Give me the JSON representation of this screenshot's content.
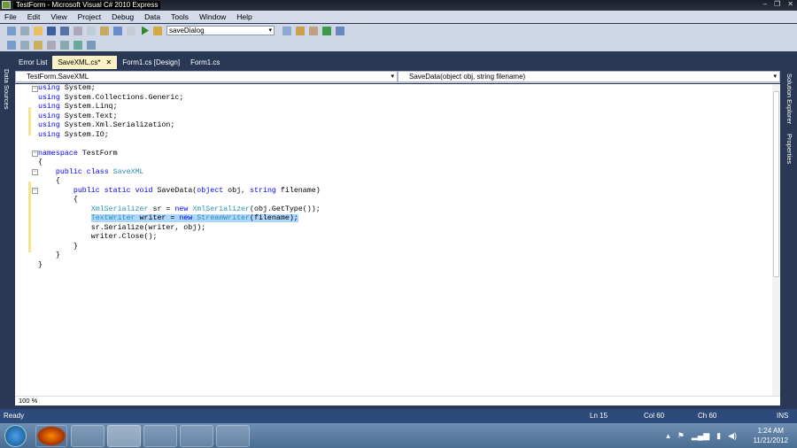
{
  "window": {
    "title": "TestForm - Microsoft Visual C# 2010 Express",
    "controls": [
      "–",
      "❐",
      "✕"
    ]
  },
  "menu": [
    "File",
    "Edit",
    "View",
    "Project",
    "Debug",
    "Data",
    "Tools",
    "Window",
    "Help"
  ],
  "toolbar": {
    "solution_config": "saveDialog"
  },
  "tabs": [
    {
      "label": "Error List",
      "active": false
    },
    {
      "label": "SaveXML.cs*",
      "active": true
    },
    {
      "label": "Form1.cs [Design]",
      "active": false
    },
    {
      "label": "Form1.cs",
      "active": false
    }
  ],
  "tab_close": "✕",
  "nav": {
    "type": "TestForm.SaveXML",
    "member": "SaveData(object obj, string filename)"
  },
  "side": {
    "left": "Data Sources",
    "right1": "Solution Explorer",
    "right2": "Properties"
  },
  "code": [
    [
      [
        "using",
        "kw"
      ],
      [
        " System;",
        ""
      ]
    ],
    [
      [
        "using",
        "kw"
      ],
      [
        " System.Collections.Generic;",
        ""
      ]
    ],
    [
      [
        "using",
        "kw"
      ],
      [
        " System.Linq;",
        ""
      ]
    ],
    [
      [
        "using",
        "kw"
      ],
      [
        " System.Text;",
        ""
      ]
    ],
    [
      [
        "using",
        "kw"
      ],
      [
        " System.Xml.Serialization;",
        ""
      ]
    ],
    [
      [
        "using",
        "kw"
      ],
      [
        " System.IO;",
        ""
      ]
    ],
    [],
    [
      [
        "namespace",
        "kw"
      ],
      [
        " TestForm",
        ""
      ]
    ],
    [
      [
        "{",
        ""
      ]
    ],
    [
      [
        "    ",
        ""
      ],
      [
        "public",
        "kw"
      ],
      [
        " ",
        ""
      ],
      [
        "class",
        "kw"
      ],
      [
        " ",
        ""
      ],
      [
        "SaveXML",
        "ty"
      ]
    ],
    [
      [
        "    {",
        ""
      ]
    ],
    [
      [
        "        ",
        ""
      ],
      [
        "public",
        "kw"
      ],
      [
        " ",
        ""
      ],
      [
        "static",
        "kw"
      ],
      [
        " ",
        ""
      ],
      [
        "void",
        "kw"
      ],
      [
        " SaveData(",
        ""
      ],
      [
        "object",
        "kw"
      ],
      [
        " obj, ",
        ""
      ],
      [
        "string",
        "kw"
      ],
      [
        " filename)",
        ""
      ]
    ],
    [
      [
        "        {",
        ""
      ]
    ],
    [
      [
        "            ",
        ""
      ],
      [
        "XmlSerializer",
        "ty"
      ],
      [
        " sr = ",
        ""
      ],
      [
        "new",
        "kw"
      ],
      [
        " ",
        ""
      ],
      [
        "XmlSerializer",
        "ty"
      ],
      [
        "(obj.GetType());",
        ""
      ]
    ],
    [
      [
        "            ",
        ""
      ],
      [
        "TextWriter",
        "ty sel"
      ],
      [
        " writer = ",
        "sel"
      ],
      [
        "new",
        "kw sel"
      ],
      [
        " ",
        "sel"
      ],
      [
        "StreamWriter",
        "ty sel"
      ],
      [
        "(filename);",
        "sel"
      ]
    ],
    [
      [
        "            sr.Serialize(writer, obj);",
        ""
      ]
    ],
    [
      [
        "            writer.Close();",
        ""
      ]
    ],
    [
      [
        "        }",
        ""
      ]
    ],
    [
      [
        "    }",
        ""
      ]
    ],
    [
      [
        "}",
        ""
      ]
    ]
  ],
  "zoom": "100 %",
  "status": {
    "ready": "Ready",
    "ln": "Ln 15",
    "col": "Col 60",
    "ch": "Ch 60",
    "ins": "INS"
  },
  "clock": {
    "time": "1:24 AM",
    "date": "11/21/2012"
  }
}
